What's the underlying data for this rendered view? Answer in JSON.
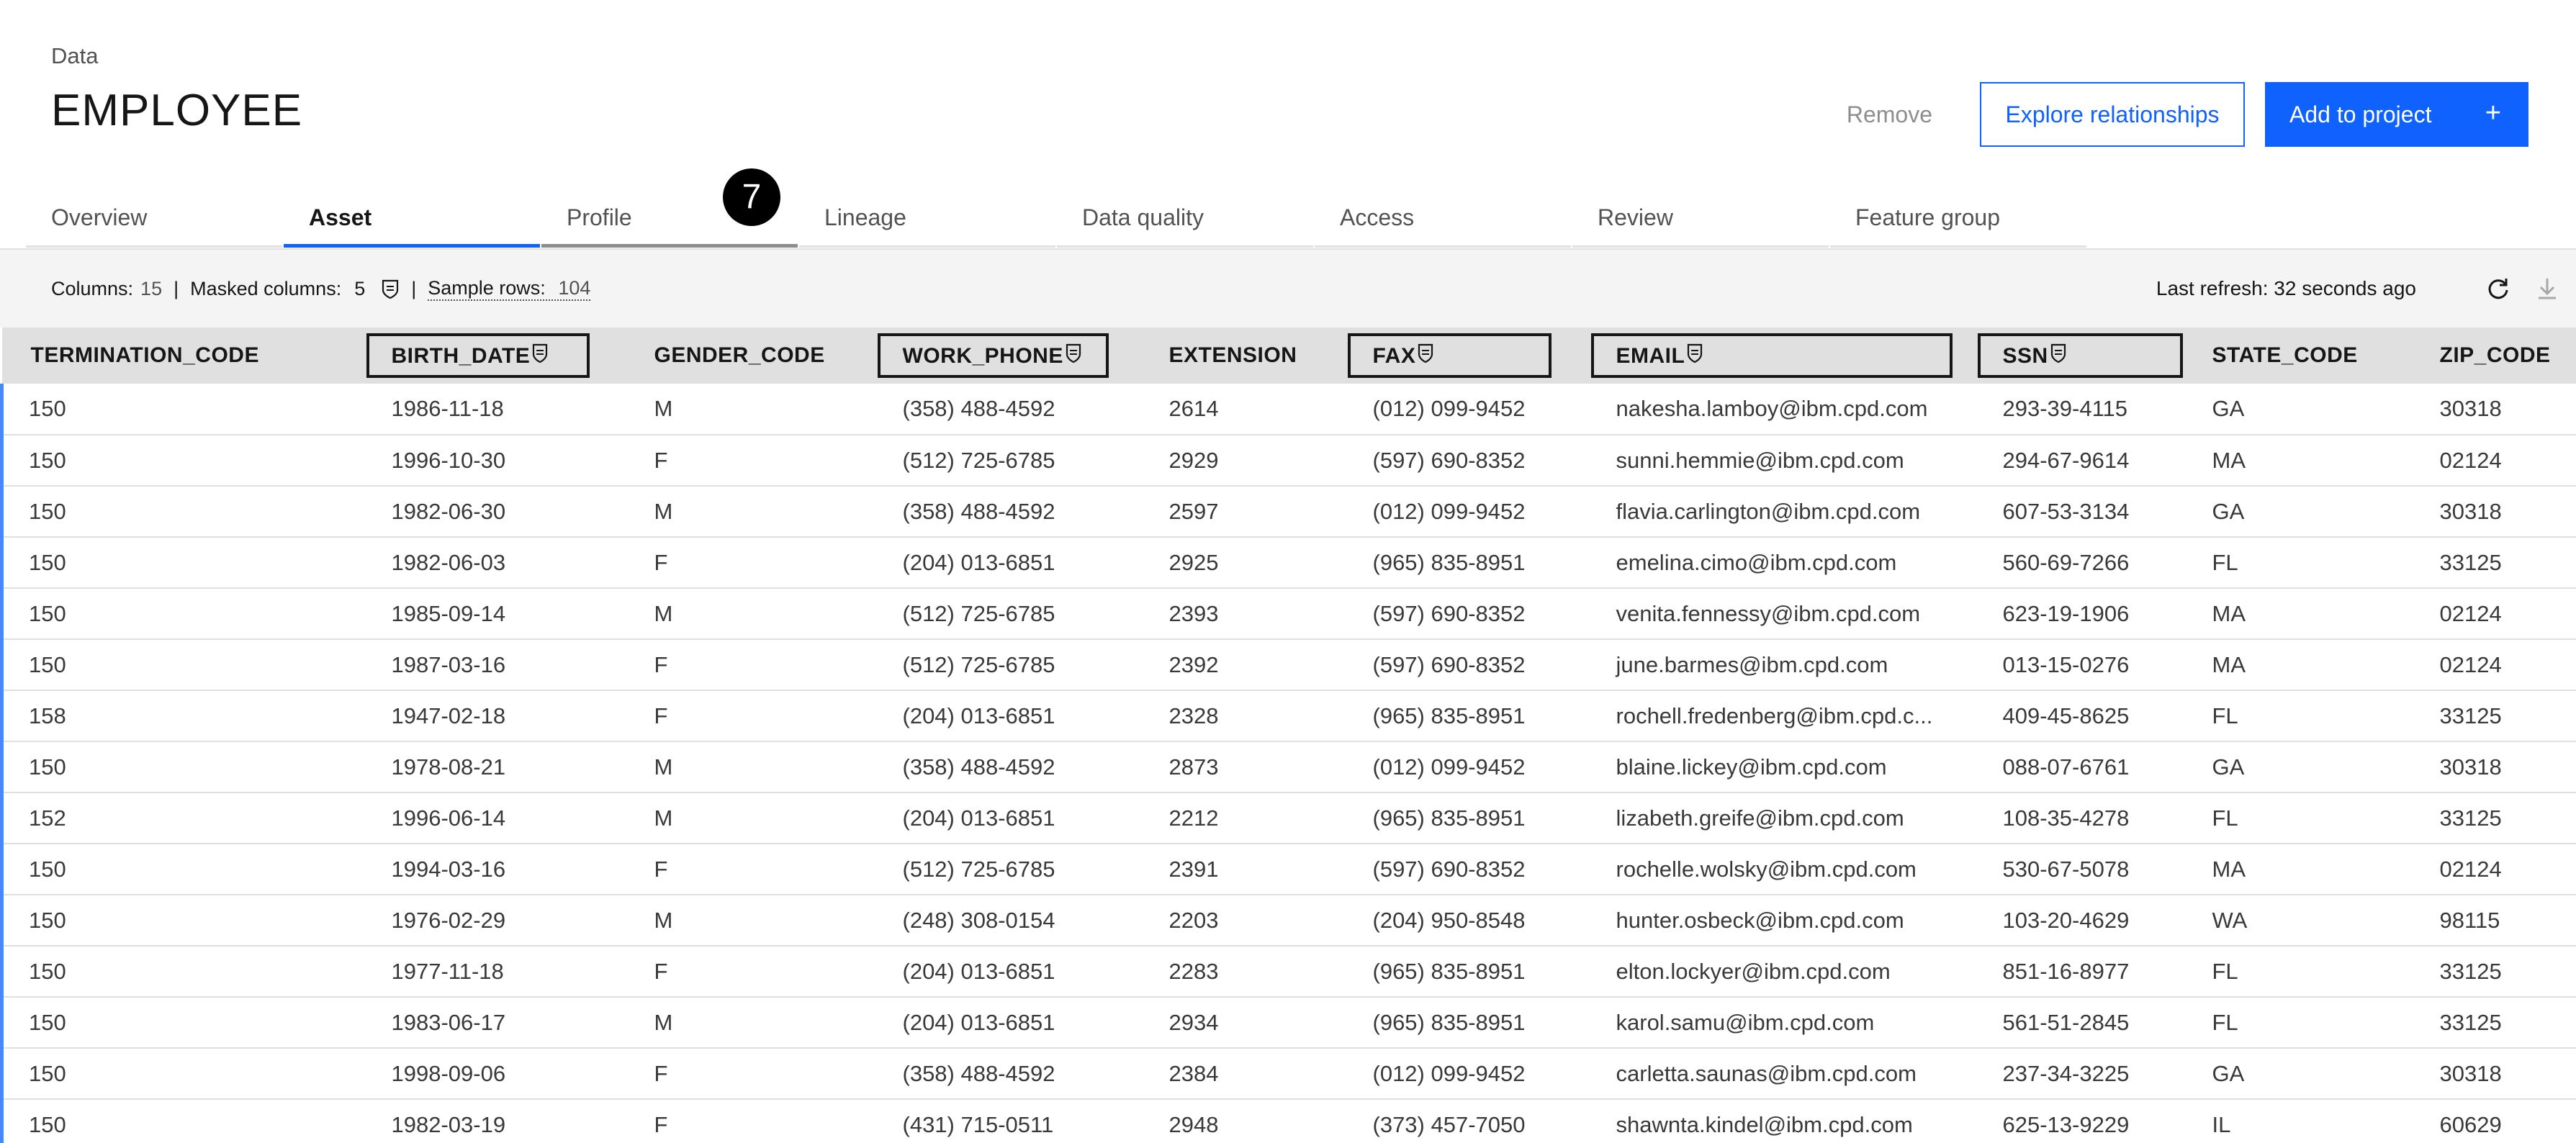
{
  "header": {
    "breadcrumb": "Data",
    "title": "EMPLOYEE",
    "remove_label": "Remove",
    "explore_label": "Explore relationships",
    "add_label": "Add to project",
    "add_icon": "+"
  },
  "tabs": [
    {
      "label": "Overview"
    },
    {
      "label": "Asset"
    },
    {
      "label": "Profile"
    },
    {
      "label": "Lineage"
    },
    {
      "label": "Data quality"
    },
    {
      "label": "Access"
    },
    {
      "label": "Review"
    },
    {
      "label": "Feature group"
    }
  ],
  "active_tab": "Asset",
  "step_badge": "7",
  "info": {
    "columns_label": "Columns:",
    "columns_value": "15",
    "masked_label": "Masked columns:",
    "masked_value": "5",
    "sample_label": "Sample rows:",
    "sample_value": "104",
    "separator": "|",
    "last_refresh": "Last refresh: 32 seconds ago"
  },
  "icons": {
    "masked": "shield-icon",
    "refresh": "refresh-icon",
    "download": "download-icon"
  },
  "colors": {
    "accent": "#0f62fe",
    "row_marker": "#4589ff",
    "header_bg": "#e0e0e0",
    "infobar_bg": "#f4f4f4"
  },
  "table": {
    "columns": [
      {
        "label": "TERMINATION_CODE",
        "masked": false
      },
      {
        "label": "BIRTH_DATE",
        "masked": true
      },
      {
        "label": "GENDER_CODE",
        "masked": false
      },
      {
        "label": "WORK_PHONE",
        "masked": true
      },
      {
        "label": "EXTENSION",
        "masked": false
      },
      {
        "label": "FAX",
        "masked": true
      },
      {
        "label": "EMAIL",
        "masked": true
      },
      {
        "label": "SSN",
        "masked": true
      },
      {
        "label": "STATE_CODE",
        "masked": false
      },
      {
        "label": "ZIP_CODE",
        "masked": false
      }
    ],
    "rows": [
      [
        "150",
        "1986-11-18",
        "M",
        "(358) 488-4592",
        "2614",
        "(012) 099-9452",
        "nakesha.lamboy@ibm.cpd.com",
        "293-39-4115",
        "GA",
        "30318"
      ],
      [
        "150",
        "1996-10-30",
        "F",
        "(512) 725-6785",
        "2929",
        "(597) 690-8352",
        "sunni.hemmie@ibm.cpd.com",
        "294-67-9614",
        "MA",
        "02124"
      ],
      [
        "150",
        "1982-06-30",
        "M",
        "(358) 488-4592",
        "2597",
        "(012) 099-9452",
        "flavia.carlington@ibm.cpd.com",
        "607-53-3134",
        "GA",
        "30318"
      ],
      [
        "150",
        "1982-06-03",
        "F",
        "(204) 013-6851",
        "2925",
        "(965) 835-8951",
        "emelina.cimo@ibm.cpd.com",
        "560-69-7266",
        "FL",
        "33125"
      ],
      [
        "150",
        "1985-09-14",
        "M",
        "(512) 725-6785",
        "2393",
        "(597) 690-8352",
        "venita.fennessy@ibm.cpd.com",
        "623-19-1906",
        "MA",
        "02124"
      ],
      [
        "150",
        "1987-03-16",
        "F",
        "(512) 725-6785",
        "2392",
        "(597) 690-8352",
        "june.barmes@ibm.cpd.com",
        "013-15-0276",
        "MA",
        "02124"
      ],
      [
        "158",
        "1947-02-18",
        "F",
        "(204) 013-6851",
        "2328",
        "(965) 835-8951",
        "rochell.fredenberg@ibm.cpd.c...",
        "409-45-8625",
        "FL",
        "33125"
      ],
      [
        "150",
        "1978-08-21",
        "M",
        "(358) 488-4592",
        "2873",
        "(012) 099-9452",
        "blaine.lickey@ibm.cpd.com",
        "088-07-6761",
        "GA",
        "30318"
      ],
      [
        "152",
        "1996-06-14",
        "M",
        "(204) 013-6851",
        "2212",
        "(965) 835-8951",
        "lizabeth.greife@ibm.cpd.com",
        "108-35-4278",
        "FL",
        "33125"
      ],
      [
        "150",
        "1994-03-16",
        "F",
        "(512) 725-6785",
        "2391",
        "(597) 690-8352",
        "rochelle.wolsky@ibm.cpd.com",
        "530-67-5078",
        "MA",
        "02124"
      ],
      [
        "150",
        "1976-02-29",
        "M",
        "(248) 308-0154",
        "2203",
        "(204) 950-8548",
        "hunter.osbeck@ibm.cpd.com",
        "103-20-4629",
        "WA",
        "98115"
      ],
      [
        "150",
        "1977-11-18",
        "F",
        "(204) 013-6851",
        "2283",
        "(965) 835-8951",
        "elton.lockyer@ibm.cpd.com",
        "851-16-8977",
        "FL",
        "33125"
      ],
      [
        "150",
        "1983-06-17",
        "M",
        "(204) 013-6851",
        "2934",
        "(965) 835-8951",
        "karol.samu@ibm.cpd.com",
        "561-51-2845",
        "FL",
        "33125"
      ],
      [
        "150",
        "1998-09-06",
        "F",
        "(358) 488-4592",
        "2384",
        "(012) 099-9452",
        "carletta.saunas@ibm.cpd.com",
        "237-34-3225",
        "GA",
        "30318"
      ],
      [
        "150",
        "1982-03-19",
        "F",
        "(431) 715-0511",
        "2948",
        "(373) 457-7050",
        "shawnta.kindel@ibm.cpd.com",
        "625-13-9229",
        "IL",
        "60629"
      ]
    ]
  }
}
